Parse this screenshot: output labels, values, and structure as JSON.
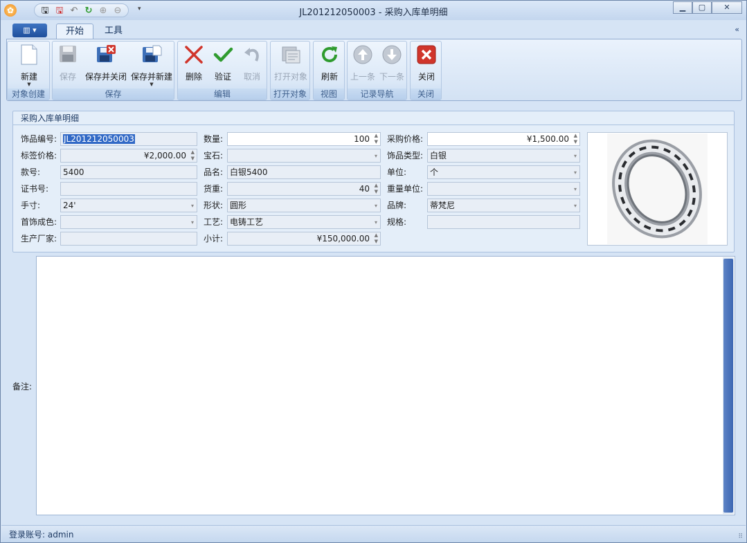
{
  "window": {
    "title": "JL201212050003 - 采购入库单明细",
    "min": "▁",
    "max": "▢",
    "close": "✕"
  },
  "qat": {
    "icons": [
      "save-icon",
      "save-close-icon",
      "undo-icon",
      "refresh-icon",
      "up-icon",
      "down-icon"
    ],
    "more": "▾"
  },
  "tabs": [
    {
      "label": "开始"
    },
    {
      "label": "工具"
    }
  ],
  "file_menu": {
    "label": "▥ ▾"
  },
  "collapse": "«",
  "ribbon": {
    "groups": [
      {
        "caption": "对象创建"
      },
      {
        "caption": "保存"
      },
      {
        "caption": "编辑"
      },
      {
        "caption": "打开对象"
      },
      {
        "caption": "视图"
      },
      {
        "caption": "记录导航"
      },
      {
        "caption": "关闭"
      }
    ],
    "buttons": {
      "new": "新建",
      "save": "保存",
      "save_close": "保存并关闭",
      "save_new": "保存并新建",
      "delete": "删除",
      "validate": "验证",
      "cancel": "取消",
      "open_object": "打开对象",
      "refresh": "刷新",
      "prev": "上一条",
      "next": "下一条",
      "close": "关闭"
    }
  },
  "panel": {
    "title": "采购入库单明细"
  },
  "form": {
    "jewelry_no": {
      "label": "饰品编号:",
      "value": "JL201212050003"
    },
    "tag_price": {
      "label": "标签价格:",
      "value": "¥2,000.00"
    },
    "style_no": {
      "label": "款号:",
      "value": "5400"
    },
    "cert_no": {
      "label": "证书号:",
      "value": ""
    },
    "hand_size": {
      "label": "手寸:",
      "value": "24'"
    },
    "jewelry_color": {
      "label": "首饰成色:",
      "value": ""
    },
    "manufacturer": {
      "label": "生产厂家:",
      "value": ""
    },
    "quantity": {
      "label": "数量:",
      "value": "100"
    },
    "gem": {
      "label": "宝石:",
      "value": ""
    },
    "product_name": {
      "label": "品名:",
      "value": "白银5400"
    },
    "goods_weight": {
      "label": "货重:",
      "value": "40"
    },
    "shape": {
      "label": "形状:",
      "value": "圆形"
    },
    "craft": {
      "label": "工艺:",
      "value": "电铸工艺"
    },
    "subtotal": {
      "label": "小计:",
      "value": "¥150,000.00"
    },
    "purchase_price": {
      "label": "采购价格:",
      "value": "¥1,500.00"
    },
    "jewelry_type": {
      "label": "饰品类型:",
      "value": "白银"
    },
    "unit": {
      "label": "单位:",
      "value": "个"
    },
    "weight_unit": {
      "label": "重量单位:",
      "value": ""
    },
    "brand": {
      "label": "品牌:",
      "value": "蒂梵尼"
    },
    "spec": {
      "label": "规格:",
      "value": ""
    }
  },
  "memo": {
    "label": "备注:"
  },
  "status": {
    "login": "登录账号: admin"
  },
  "colors": {
    "accent": "#1f4f9c",
    "delete": "#d0352b",
    "validate": "#2f9b2f",
    "refresh": "#2f9b2f"
  }
}
